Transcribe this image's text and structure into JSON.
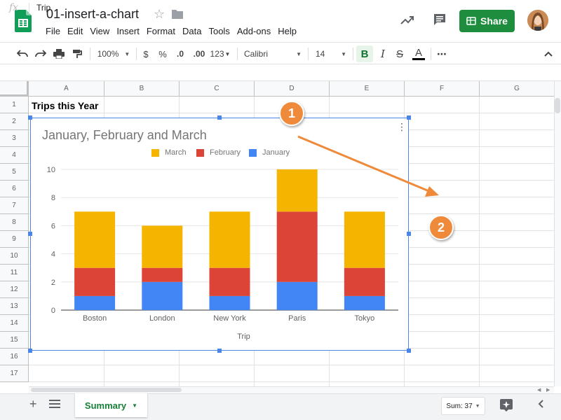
{
  "document": {
    "title": "01-insert-a-chart"
  },
  "menu": [
    "File",
    "Edit",
    "View",
    "Insert",
    "Format",
    "Data",
    "Tools",
    "Add-ons",
    "Help"
  ],
  "header": {
    "share_label": "Share"
  },
  "toolbar": {
    "zoom": "100%",
    "currency": "$",
    "percent": "%",
    "decrease_decimal": ".0",
    "increase_decimal": ".00",
    "number_format": "123",
    "font": "Calibri",
    "font_size": "14",
    "bold": "B",
    "italic": "I",
    "strikethrough": "S",
    "text_color": "A",
    "more": "⋯"
  },
  "formula_bar": {
    "fx": "fx",
    "value": "Trip"
  },
  "grid": {
    "columns": [
      "A",
      "B",
      "C",
      "D",
      "E",
      "F",
      "G"
    ],
    "rows": [
      "1",
      "2",
      "3",
      "4",
      "5",
      "6",
      "7",
      "8",
      "9",
      "10",
      "11",
      "12",
      "13",
      "14",
      "15",
      "16",
      "17"
    ],
    "a1": "Trips this Year"
  },
  "chart_data": {
    "type": "bar",
    "stacked": true,
    "title": "January, February and March",
    "xlabel": "Trip",
    "ylabel": "",
    "categories": [
      "Boston",
      "London",
      "New York",
      "Paris",
      "Tokyo"
    ],
    "series": [
      {
        "name": "January",
        "values": [
          1,
          2,
          1,
          2,
          1
        ],
        "color": "#4285f4"
      },
      {
        "name": "February",
        "values": [
          2,
          1,
          2,
          5,
          2
        ],
        "color": "#db4437"
      },
      {
        "name": "March",
        "values": [
          4,
          3,
          4,
          3,
          4
        ],
        "color": "#f4b400"
      }
    ],
    "legend_order": [
      "March",
      "February",
      "January"
    ],
    "ylim": [
      0,
      10
    ],
    "yticks": [
      "0",
      "2",
      "4",
      "6",
      "8",
      "10"
    ],
    "grid": true,
    "legend_position": "top"
  },
  "callouts": [
    "1",
    "2"
  ],
  "bottom": {
    "sheet_name": "Summary",
    "sum_label": "Sum: 37"
  },
  "colors": {
    "accent": "#4a86e8",
    "share": "#1e8e3e",
    "callout": "#ee8a3a",
    "sheet_tab": "#188038"
  }
}
